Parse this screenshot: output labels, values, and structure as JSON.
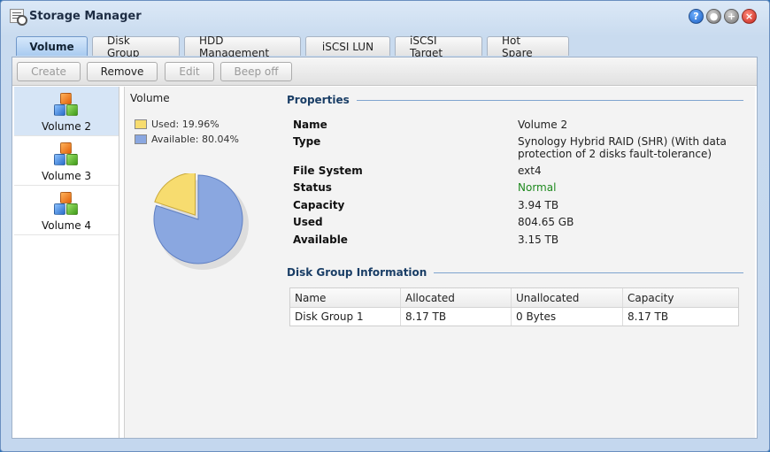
{
  "window": {
    "title": "Storage Manager"
  },
  "tabs": [
    {
      "label": "Volume",
      "active": true
    },
    {
      "label": "Disk Group"
    },
    {
      "label": "HDD Management"
    },
    {
      "label": "iSCSI LUN"
    },
    {
      "label": "iSCSI Target"
    },
    {
      "label": "Hot Spare"
    }
  ],
  "toolbar": {
    "create_label": "Create",
    "remove_label": "Remove",
    "edit_label": "Edit",
    "beep_off_label": "Beep off"
  },
  "volumes": [
    {
      "label": "Volume 2",
      "selected": true
    },
    {
      "label": "Volume 3"
    },
    {
      "label": "Volume 4"
    }
  ],
  "usage": {
    "title": "Volume",
    "used_label": "Used: 19.96%",
    "available_label": "Available: 80.04%",
    "used_percent": 19.96,
    "available_percent": 80.04,
    "used_color": "#f7dc6f",
    "available_color": "#8aa7e0"
  },
  "properties": {
    "title": "Properties",
    "rows": [
      {
        "name": "Name",
        "value": "Volume 2"
      },
      {
        "name": "Type",
        "value": "Synology Hybrid RAID (SHR) (With data protection of 2 disks fault-tolerance)"
      },
      {
        "name": "File System",
        "value": "ext4"
      },
      {
        "name": "Status",
        "value": "Normal"
      },
      {
        "name": "Capacity",
        "value": "3.94 TB"
      },
      {
        "name": "Used",
        "value": "804.65 GB"
      },
      {
        "name": "Available",
        "value": "3.15 TB"
      }
    ]
  },
  "disk_group": {
    "title": "Disk Group Information",
    "columns": [
      "Name",
      "Allocated",
      "Unallocated",
      "Capacity"
    ],
    "rows": [
      [
        "Disk Group 1",
        "8.17 TB",
        "0 Bytes",
        "8.17 TB"
      ]
    ]
  },
  "colors": {
    "accent": "#1a3e66",
    "status_normal": "#1f8a1f",
    "tab_active": "#a9cbf0"
  }
}
